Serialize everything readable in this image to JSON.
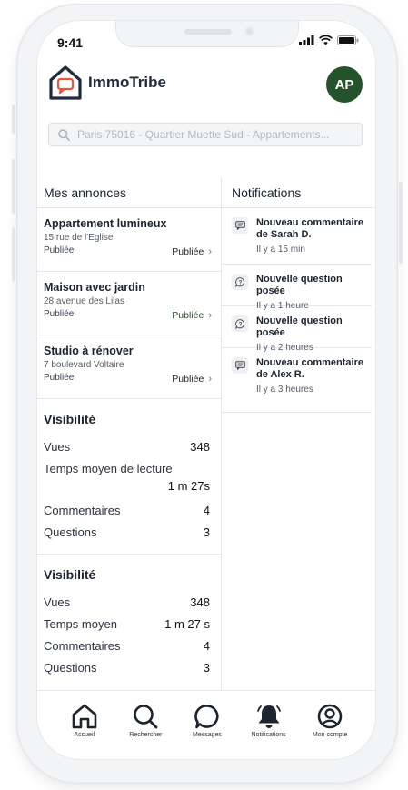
{
  "status_bar": {
    "time": "9:41"
  },
  "header": {
    "app_name": "ImmoTribe",
    "avatar_initials": "AP"
  },
  "search": {
    "placeholder": "Paris 75016 - Quartier Muette Sud - Appartements..."
  },
  "listings": {
    "title": "Mes annonces",
    "items": [
      {
        "title": "Appartement lumineux",
        "address": "15 rue de l'Eglise",
        "status": "Publiée",
        "badge": "Publiée"
      },
      {
        "title": "Maison avec jardin",
        "address": "28 avenue des Lilas",
        "status": "Publiée",
        "badge": "Publiée"
      },
      {
        "title": "Studio à rénover",
        "address": "7 boulevard Voltaire",
        "status": "Publiée",
        "badge": "Publiée"
      }
    ]
  },
  "visibility1": {
    "title": "Visibilité",
    "views_label": "Vues",
    "views": "348",
    "read_time_label": "Temps moyen de lecture",
    "read_time": "1 m 27s",
    "comments_label": "Commentaires",
    "comments": "4",
    "questions_label": "Questions",
    "questions": "3"
  },
  "visibility2": {
    "title": "Visibilité",
    "views_label": "Vues",
    "views": "348",
    "read_time_label": "Temps moyen",
    "read_time": "1 m 27 s",
    "comments_label": "Commentaires",
    "comments": "4",
    "questions_label": "Questions",
    "questions": "3"
  },
  "notifications": {
    "title": "Notifications",
    "items": [
      {
        "icon": "comment-icon",
        "title": "Nouveau commentaire de Sarah D.",
        "time": "Il y a 15 min"
      },
      {
        "icon": "question-icon",
        "title": "Nouvelle question posée",
        "time": "Il y a 1 heure"
      },
      {
        "icon": "question-icon",
        "title": "Nouvelle question posée",
        "time": "Il y a 2 heures"
      },
      {
        "icon": "comment-icon",
        "title": "Nouveau commentaire de Alex R.",
        "time": "Il y a 3 heures"
      }
    ]
  },
  "nav": {
    "home": "Accueil",
    "search": "Rechercher",
    "messages": "Messages",
    "notifications": "Notifications",
    "account": "Mon compte"
  },
  "colors": {
    "brand_green": "#23522b",
    "logo_orange": "#e8553a"
  }
}
